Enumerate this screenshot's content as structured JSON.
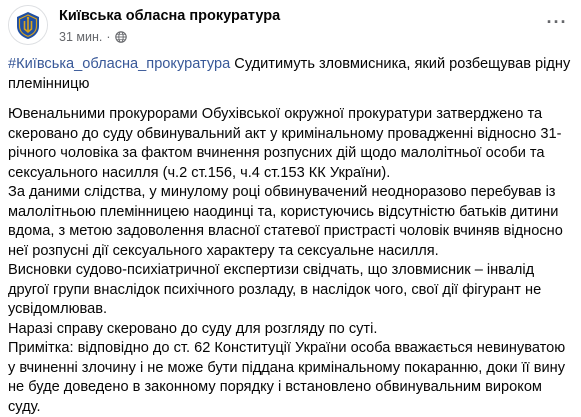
{
  "post": {
    "author": "Київська обласна прокуратура",
    "time": "31 мин.",
    "separator": "·",
    "more_label": "···",
    "hashtag": "#Київська_обласна_прокуратура",
    "headline_text": " Судитимуть зловмисника, який розбещував рідну племінницю",
    "paragraphs": [
      "Ювенальними прокурорами Обухівської окружної прокуратури затверджено та скеровано до суду обвинувальний акт у кримінальному провадженні відносно 31-річного чоловіка за фактом вчинення розпусних дій щодо малолітньої особи та сексуального насилля (ч.2 ст.156, ч.4 ст.153 КК України).",
      "За даними слідства, у минулому році обвинувачений неодноразово перебував із малолітньою племінницею наодинці та, користуючись відсутністю батьків дитини вдома, з метою задоволення власної статевої пристрасті чоловік вчиняв відносно неї розпусні дії сексуального характеру та сексуальне насилля.",
      "Висновки судово-психіатричної експертизи свідчать, що зловмисник – інвалід другої групи внаслідок психічного розладу, в наслідок чого, свої дії фігурант не усвідомлював.",
      "Наразі справу скеровано до суду для розгляду по суті.",
      "Примітка: відповідно до ст. 62 Конституції України особа вважається невинуватою у вчиненні злочину і не може бути піддана кримінальному покаранню, доки її вину не буде доведено в законному порядку і встановлено обвинувальним вироком суду."
    ]
  },
  "icons": {
    "avatar": "prosecutor-emblem",
    "audience": "globe-icon",
    "more": "more-options-icon"
  },
  "colors": {
    "hashtag": "#385898",
    "meta": "#65676b",
    "text": "#050505",
    "emblem_blue": "#1f4fa3",
    "emblem_gold": "#d6a21e"
  }
}
